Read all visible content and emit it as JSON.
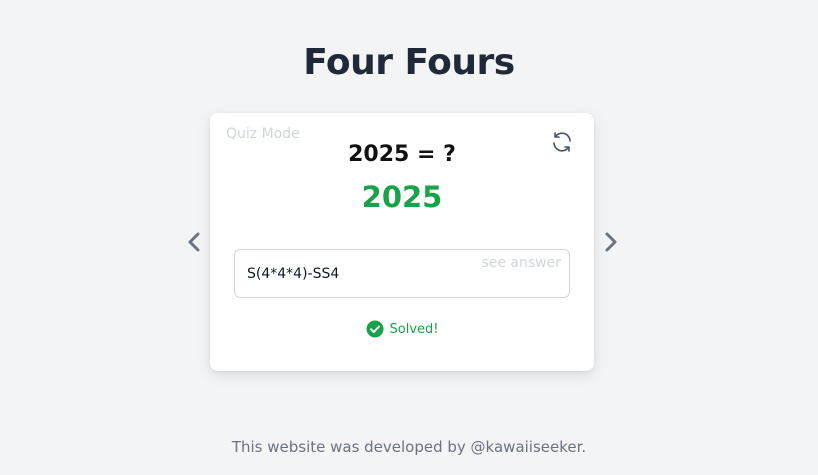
{
  "page": {
    "title": "Four Fours"
  },
  "card": {
    "mode_label": "Quiz Mode",
    "question": "2025 = ?",
    "target_number": "2025",
    "input": {
      "value": "S(4*4*4)-SS4",
      "see_answer_label": "see answer"
    },
    "status": {
      "text": "Solved!",
      "icon": "check-circle-icon",
      "color": "#16a34a"
    },
    "refresh_icon": "refresh-icon"
  },
  "navigation": {
    "prev_icon": "chevron-left-icon",
    "next_icon": "chevron-right-icon"
  },
  "footer": {
    "text": "This website was developed by @kawaiiseeker."
  },
  "colors": {
    "background": "#f3f4f6",
    "title": "#1f2937",
    "success": "#16a34a",
    "muted": "#d1d5db",
    "footer": "#6b7280"
  }
}
